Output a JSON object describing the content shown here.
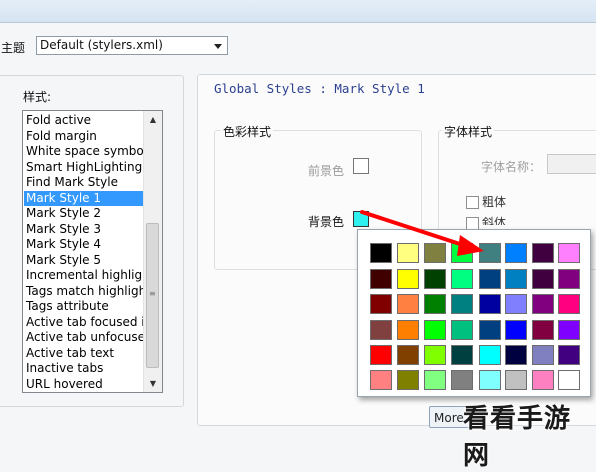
{
  "theme": {
    "label": "主题",
    "selected": "Default (stylers.xml)"
  },
  "style_list": {
    "caption": "样式:",
    "items": [
      "Fold active",
      "Fold margin",
      "White space symbol",
      "Smart HighLighting",
      "Find Mark Style",
      "Mark Style 1",
      "Mark Style 2",
      "Mark Style 3",
      "Mark Style 4",
      "Mark Style 5",
      "Incremental highlight all",
      "Tags match highlighting",
      "Tags attribute",
      "Active tab focused indicator",
      "Active tab unfocused indicator",
      "Active tab text",
      "Inactive tabs",
      "URL hovered"
    ],
    "selected_index": 5
  },
  "panel": {
    "title": "Global Styles : Mark Style 1",
    "colour_group": "色彩样式",
    "fg_label": "前景色",
    "bg_label": "背景色",
    "fg_color": "#ffffff",
    "bg_color": "#2ef0ee",
    "font_group": "字体样式",
    "font_name_label": "字体名称：",
    "bold_label": "粗体",
    "italic_label": "斜体"
  },
  "palette": {
    "colors": [
      [
        "#000000",
        "#ffff80",
        "#808040",
        "#00ff40",
        "#408080",
        "#0080ff",
        "#400040",
        "#ff80ff"
      ],
      [
        "#400000",
        "#ffff00",
        "#004000",
        "#00ff80",
        "#004080",
        "#0080c0",
        "#400040",
        "#800080"
      ],
      [
        "#800000",
        "#ff8040",
        "#008000",
        "#008080",
        "#0000a0",
        "#8080ff",
        "#800080",
        "#ff0080"
      ],
      [
        "#804040",
        "#ff8000",
        "#00ff00",
        "#00c080",
        "#004080",
        "#0000ff",
        "#800040",
        "#8000ff"
      ],
      [
        "#ff0000",
        "#804000",
        "#80ff00",
        "#004040",
        "#00ffff",
        "#000040",
        "#8080c0",
        "#400080"
      ],
      [
        "#ff8080",
        "#808000",
        "#80ff80",
        "#808080",
        "#80ffff",
        "#c0c0c0",
        "#ff80c0",
        "#ffffff"
      ]
    ]
  },
  "more_button": "More",
  "watermark": "看看手游网",
  "accent": {
    "selection": "#3399ff",
    "arrow": "#ff0000"
  }
}
